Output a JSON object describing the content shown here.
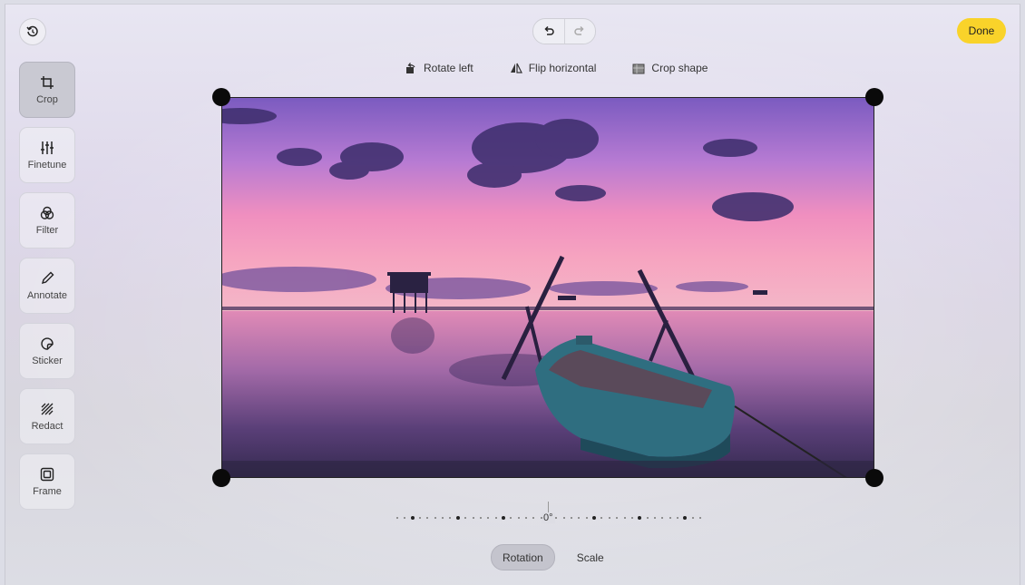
{
  "header": {
    "done_label": "Done"
  },
  "icons": {
    "history": "history-icon",
    "undo": "undo-icon",
    "redo": "redo-icon"
  },
  "crop_toolbar": {
    "rotate_left": "Rotate left",
    "flip_horizontal": "Flip horizontal",
    "crop_shape": "Crop shape"
  },
  "tools": [
    {
      "label": "Crop",
      "icon": "crop-icon",
      "active": true
    },
    {
      "label": "Finetune",
      "icon": "sliders-icon"
    },
    {
      "label": "Filter",
      "icon": "filter-icon"
    },
    {
      "label": "Annotate",
      "icon": "pencil-icon"
    },
    {
      "label": "Sticker",
      "icon": "sticker-icon"
    },
    {
      "label": "Redact",
      "icon": "redact-icon"
    },
    {
      "label": "Frame",
      "icon": "frame-icon"
    }
  ],
  "rotation": {
    "value_label": "0°"
  },
  "tabs": {
    "rotation": "Rotation",
    "scale": "Scale",
    "active": "Rotation"
  },
  "colors": {
    "accent": "#f9d32a",
    "active_tool": "#c9c9d2",
    "handle": "#0a0a0a"
  }
}
